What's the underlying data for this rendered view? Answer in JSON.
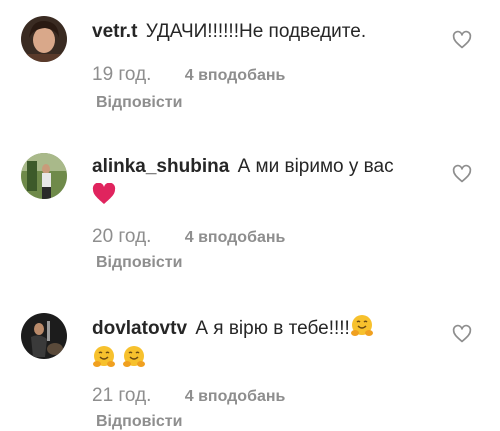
{
  "comments": [
    {
      "username": "vetr.t",
      "text": "УДАЧИ!!!!!!Не подведите.",
      "time": "19 год.",
      "likes": "4 вподобань",
      "reply": "Відповісти"
    },
    {
      "username": "alinka_shubina",
      "text": "А ми віримо у вас",
      "emoji_line": "❤️",
      "time": "20 год.",
      "likes": "4 вподобань",
      "reply": "Відповісти"
    },
    {
      "username": "dovlatovtv",
      "text": "А я вірю в тебе!!!!",
      "emoji_line": "🤗🤗🤗",
      "time": "21 год.",
      "likes": "4 вподобань",
      "reply": "Відповісти"
    }
  ],
  "icons": {
    "like": "heart-outline-icon",
    "hug": "hugging-face-emoji",
    "love": "red-heart-emoji"
  },
  "colors": {
    "text": "#262626",
    "meta": "#8e8e8e",
    "heart_red": "#e0245e",
    "emoji_yellow": "#f7c12d"
  }
}
